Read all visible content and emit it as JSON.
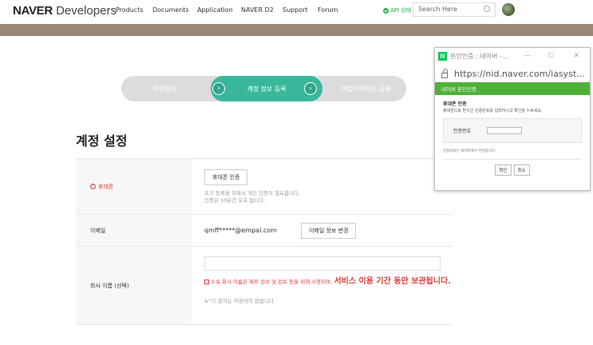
{
  "header": {
    "logo_bold": "NAVER",
    "logo_light": " Developers",
    "nav": [
      "Products",
      "Documents",
      "Application",
      "NAVER D2",
      "Support",
      "Forum"
    ],
    "api_status": "API 상태",
    "search_placeholder": "Search Here",
    "icons": {
      "api_status": "check-circle-icon",
      "search": "search-icon",
      "avatar": "avatar"
    }
  },
  "steps": {
    "step1": "약관동의",
    "step2": "계정 정보 등록",
    "step3": "애플리케이션 등록",
    "active_color": "#39b79a",
    "inactive_color": "#dcdcdc"
  },
  "page_title": "계정 설정",
  "form": {
    "phone": {
      "label": "휴대폰",
      "button": "휴대폰 인증",
      "hint1": "초기 등록을 위해서 개인 인증이 필요합니다.",
      "hint2": "인증은 10분간 유효 합니다."
    },
    "email": {
      "label": "이메일",
      "value": "qmff*****@empal.com",
      "button": "이메일 정보 변경"
    },
    "company": {
      "label": "회사 이름 (선택)",
      "warn_small": "소속 회사 이름은 제휴 검수 및 검토 등을 위해 사용되며,",
      "warn_big": "서비스 이용 기간 동안 보관됩니다.",
      "hint": "&\"'() 문자는 허용하지 않습니다."
    }
  },
  "popup": {
    "title": "본인인증 : 네이버 -...",
    "url": "https://nid.naver.com/iasyst...",
    "brand_letter": "N",
    "green_bar": "네이버 본인인증",
    "body_title": "휴대폰 인증",
    "body_desc": "휴대폰으로 받으신 인증번호를 입력하시고 확인을 누르세요.",
    "code_label": "인증번호",
    "note": "인증비용은 네이버에서 부담합니다.",
    "confirm": "확인",
    "cancel": "취소",
    "win_min": "—",
    "win_max": "☐",
    "win_close": "✕",
    "green_color": "#4fb03a"
  }
}
